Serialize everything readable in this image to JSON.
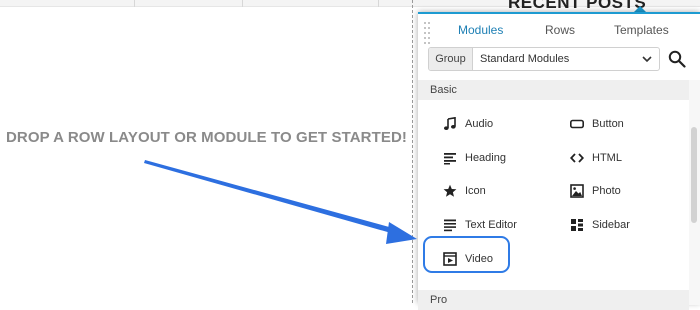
{
  "canvas": {
    "drop_message": "DROP A ROW LAYOUT OR MODULE TO GET STARTED!",
    "partial_heading": "RECENT POSTS"
  },
  "panel": {
    "tabs": [
      {
        "label": "Modules",
        "active": true
      },
      {
        "label": "Rows",
        "active": false
      },
      {
        "label": "Templates",
        "active": false
      }
    ],
    "group": {
      "label": "Group",
      "value": "Standard Modules"
    },
    "sections": [
      {
        "title": "Basic",
        "modules": [
          {
            "label": "Audio",
            "icon": "music-note-icon"
          },
          {
            "label": "Button",
            "icon": "button-icon"
          },
          {
            "label": "Heading",
            "icon": "heading-icon"
          },
          {
            "label": "HTML",
            "icon": "code-icon"
          },
          {
            "label": "Icon",
            "icon": "star-icon"
          },
          {
            "label": "Photo",
            "icon": "photo-icon"
          },
          {
            "label": "Text Editor",
            "icon": "text-editor-icon"
          },
          {
            "label": "Sidebar",
            "icon": "sidebar-icon"
          },
          {
            "label": "Video",
            "icon": "video-icon"
          }
        ]
      },
      {
        "title": "Pro",
        "modules": []
      }
    ]
  },
  "colors": {
    "accent": "#1d9bd1",
    "highlight": "#2f7be6",
    "drop_message": "#8a8a8a"
  }
}
